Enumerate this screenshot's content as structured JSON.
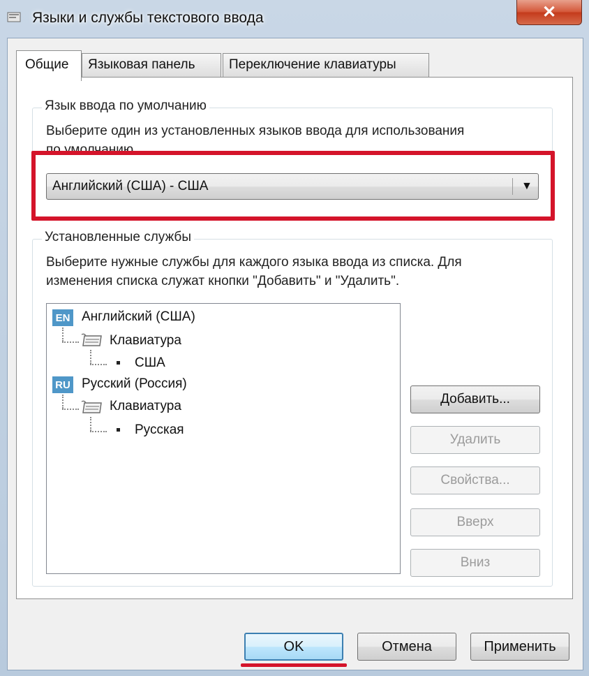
{
  "window": {
    "title": "Языки и службы текстового ввода",
    "close_label": "✕"
  },
  "tabs": [
    {
      "label": "Общие",
      "active": true
    },
    {
      "label": "Языковая панель",
      "active": false
    },
    {
      "label": "Переключение клавиатуры",
      "active": false
    }
  ],
  "default_language": {
    "group_title": "Язык ввода по умолчанию",
    "description_line1": "Выберите один из установленных языков ввода для использования",
    "description_line2": "по умолчанию",
    "selected_value": "Английский (США) - США",
    "highlight_color": "#d4142a"
  },
  "installed_services": {
    "group_title": "Установленные службы",
    "description_line1": "Выберите нужные службы для каждого языка ввода из списка. Для",
    "description_line2": "изменения списка служат кнопки \"Добавить\" и \"Удалить\".",
    "tree": [
      {
        "badge": "EN",
        "language": "Английский (США)",
        "category": "Клавиатура",
        "layout": "США"
      },
      {
        "badge": "RU",
        "language": "Русский (Россия)",
        "category": "Клавиатура",
        "layout": "Русская"
      }
    ],
    "buttons": {
      "add": "Добавить...",
      "remove": "Удалить",
      "properties": "Свойства...",
      "up": "Вверх",
      "down": "Вниз"
    }
  },
  "dialog_buttons": {
    "ok": "OK",
    "cancel": "Отмена",
    "apply": "Применить"
  },
  "colors": {
    "lang_badge": "#4f97c8",
    "annotation_red": "#d4142a"
  }
}
